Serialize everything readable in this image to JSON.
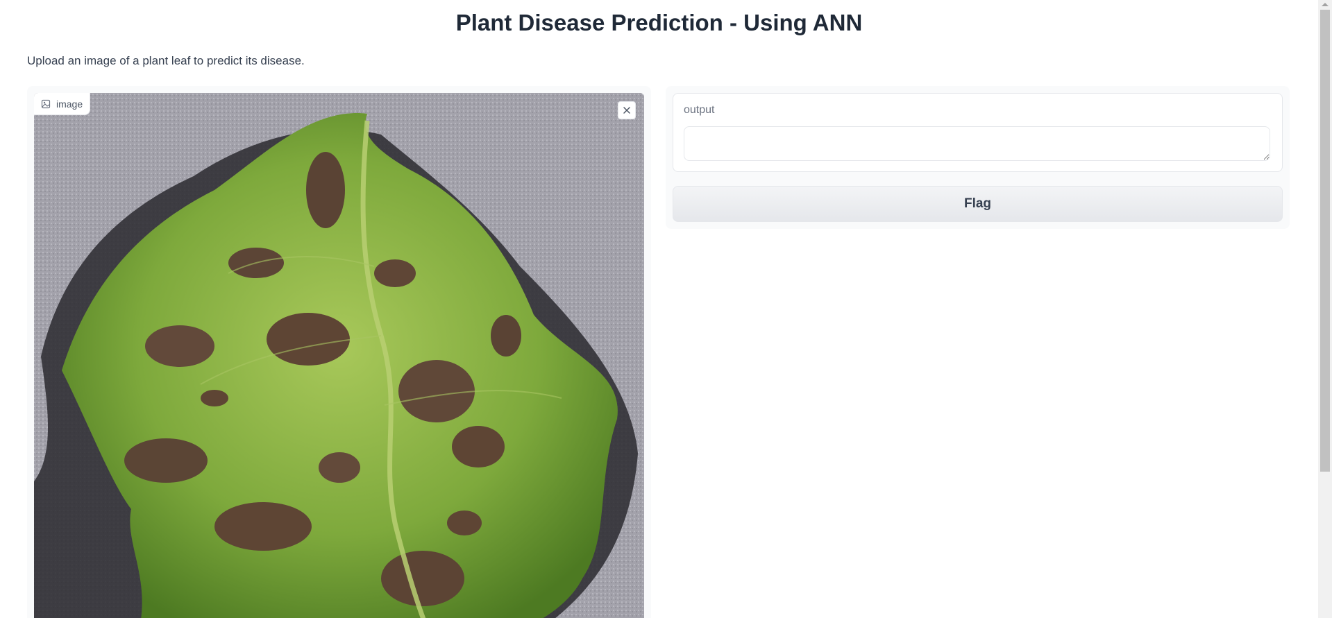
{
  "app": {
    "title": "Plant Disease Prediction - Using ANN",
    "description": "Upload an image of a plant leaf to predict its disease."
  },
  "input_image": {
    "label": "image",
    "label_icon": "image-icon",
    "clear_icon": "close-icon"
  },
  "output": {
    "label": "output",
    "value": ""
  },
  "actions": {
    "flag_label": "Flag"
  },
  "colors": {
    "background": "#ffffff",
    "panel": "#f9fafb",
    "border": "#e5e7eb",
    "leaf_green": "#7fae3e",
    "lesion_brown": "#5e4534",
    "pavement_gray": "#9b9ba3"
  }
}
